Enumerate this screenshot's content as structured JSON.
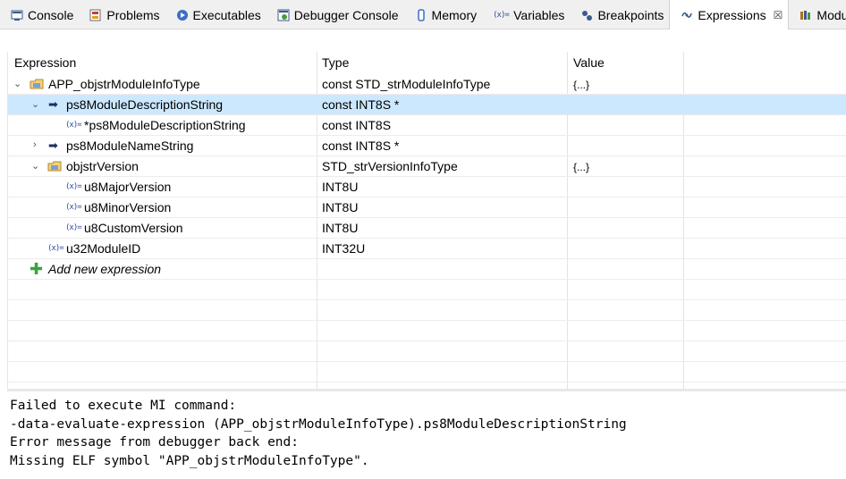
{
  "tabs": [
    {
      "label": "Console",
      "icon": "console-icon"
    },
    {
      "label": "Problems",
      "icon": "problems-icon"
    },
    {
      "label": "Executables",
      "icon": "executables-icon"
    },
    {
      "label": "Debugger Console",
      "icon": "debugger-console-icon"
    },
    {
      "label": "Memory",
      "icon": "memory-icon"
    },
    {
      "label": "Variables",
      "icon": "variables-icon"
    },
    {
      "label": "Breakpoints",
      "icon": "breakpoints-icon"
    },
    {
      "label": "Expressions",
      "icon": "expressions-icon",
      "active": true
    },
    {
      "label": "Modules",
      "icon": "modules-icon"
    }
  ],
  "table": {
    "headers": {
      "expression": "Expression",
      "type": "Type",
      "value": "Value"
    },
    "rows": [
      {
        "expression": "APP_objstrModuleInfoType",
        "type": "const STD_strModuleInfoType",
        "value": "{...}",
        "icon": "struct-icon",
        "twisty": "expanded"
      },
      {
        "expression": "ps8ModuleDescriptionString",
        "type": "const INT8S *",
        "value": "",
        "icon": "pointer-icon",
        "twisty": "expanded",
        "selected": true
      },
      {
        "expression": "*ps8ModuleDescriptionString",
        "type": "const INT8S",
        "value": "",
        "icon": "variable-icon",
        "twisty": ""
      },
      {
        "expression": "ps8ModuleNameString",
        "type": "const INT8S *",
        "value": "",
        "icon": "pointer-icon",
        "twisty": "collapsed"
      },
      {
        "expression": "objstrVersion",
        "type": "STD_strVersionInfoType",
        "value": "{...}",
        "icon": "struct-icon",
        "twisty": "expanded"
      },
      {
        "expression": "u8MajorVersion",
        "type": "INT8U",
        "value": "",
        "icon": "variable-icon",
        "twisty": ""
      },
      {
        "expression": "u8MinorVersion",
        "type": "INT8U",
        "value": "",
        "icon": "variable-icon",
        "twisty": ""
      },
      {
        "expression": "u8CustomVersion",
        "type": "INT8U",
        "value": "",
        "icon": "variable-icon",
        "twisty": ""
      },
      {
        "expression": "u32ModuleID",
        "type": "INT32U",
        "value": "",
        "icon": "variable-icon",
        "twisty": ""
      }
    ],
    "add_new": "Add new expression"
  },
  "variable_icon_glyph": "(x)=",
  "details": [
    "Failed to execute MI command:",
    "-data-evaluate-expression (APP_objstrModuleInfoType).ps8ModuleDescriptionString",
    "Error message from debugger back end:",
    "Missing ELF symbol \"APP_objstrModuleInfoType\"."
  ],
  "colors": {
    "selection": "#cce8ff",
    "tabbar": "#f0f0f0",
    "add_icon": "#3aa33a"
  }
}
